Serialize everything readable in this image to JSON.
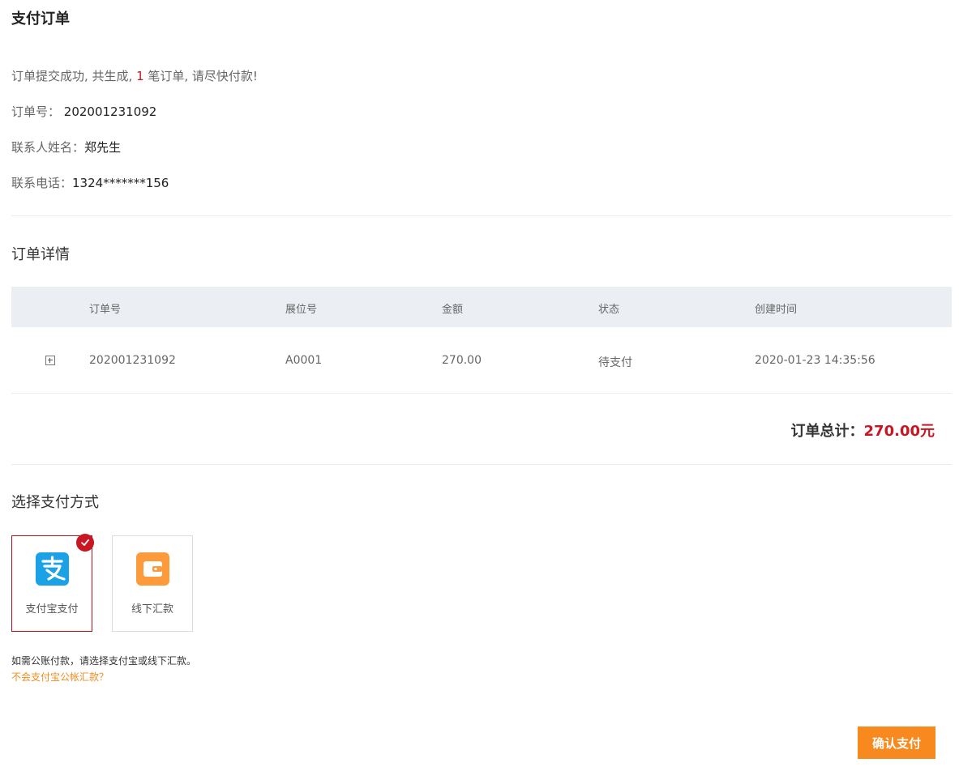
{
  "page": {
    "title": "支付订单"
  },
  "summary": {
    "message_prefix": "订单提交成功, 共生成, ",
    "order_count": "1",
    "message_suffix": " 笔订单, 请尽快付款!",
    "order_no_label": "订单号：",
    "order_no": "202001231092",
    "contact_name_label": "联系人姓名：",
    "contact_name": "郑先生",
    "contact_phone_label": "联系电话：",
    "contact_phone": "1324*******156"
  },
  "details": {
    "title": "订单详情",
    "columns": [
      "订单号",
      "展位号",
      "金额",
      "状态",
      "创建时间"
    ],
    "rows": [
      {
        "order_no": "202001231092",
        "booth_no": "A0001",
        "amount": "270.00",
        "status": "待支付",
        "created_at": "2020-01-23 14:35:56"
      }
    ],
    "total_label": "订单总计：",
    "total_amount": "270.00元"
  },
  "payment": {
    "title": "选择支付方式",
    "methods": [
      {
        "label": "支付宝支付",
        "icon": "alipay-icon",
        "color": "#1aa1e6",
        "selected": true
      },
      {
        "label": "线下汇款",
        "icon": "wallet-icon",
        "color": "#fc9a3c",
        "selected": false
      }
    ],
    "note": "如需公账付款，请选择支付宝或线下汇款。",
    "help_link": "不会支付宝公帐汇款？",
    "confirm_label": "确认支付"
  },
  "colors": {
    "accent_red": "#c81623",
    "confirm_orange": "#f7891f",
    "link_orange": "#f18c1c",
    "table_header_bg": "#ebeef2"
  }
}
